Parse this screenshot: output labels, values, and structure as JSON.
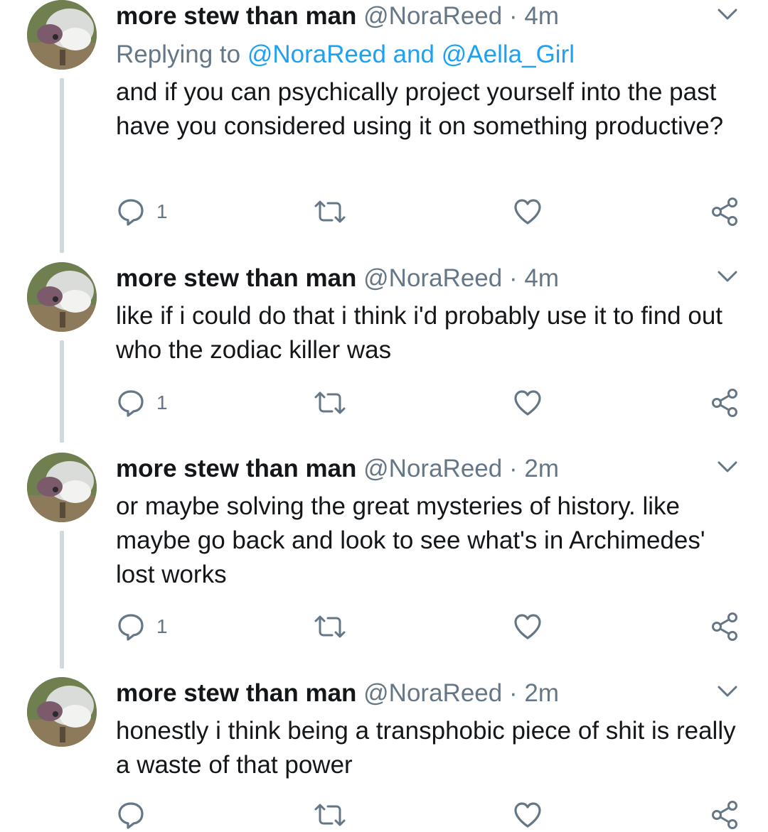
{
  "colors": {
    "name": "#14171a",
    "meta": "#657786",
    "link": "#1da1f2",
    "thread_line": "#cfd9de",
    "icon": "#657786"
  },
  "icons": {
    "reply": "reply-icon",
    "retweet": "retweet-icon",
    "like": "heart-icon",
    "share": "share-icon",
    "menu": "chevron-down-icon"
  },
  "tweets": [
    {
      "name": "more stew than man",
      "handle": "@NoraReed",
      "separator": "·",
      "time": "4m",
      "replying_prefix": "Replying to",
      "replying_to": "@NoraReed and @Aella_Girl",
      "text": "and if you can psychically project yourself into the past have you considered using it on something productive?",
      "reply_count": "1"
    },
    {
      "name": "more stew than man",
      "handle": "@NoraReed",
      "separator": "·",
      "time": "4m",
      "text": "like if i could do that i think i'd probably use it to find out who the zodiac killer was",
      "reply_count": "1"
    },
    {
      "name": "more stew than man",
      "handle": "@NoraReed",
      "separator": "·",
      "time": "2m",
      "text": "or maybe solving the great mysteries of history. like maybe go back and look to see what's in Archimedes' lost works",
      "reply_count": "1"
    },
    {
      "name": "more stew than man",
      "handle": "@NoraReed",
      "separator": "·",
      "time": "2m",
      "text": "honestly i think being a transphobic piece of shit is really a waste of that power",
      "reply_count": ""
    }
  ]
}
